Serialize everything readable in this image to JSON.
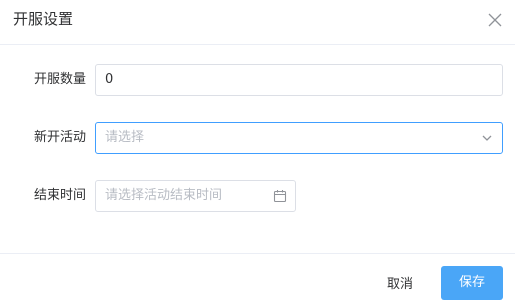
{
  "dialog": {
    "title": "开服设置"
  },
  "form": {
    "server_count": {
      "label": "开服数量",
      "value": "0"
    },
    "new_activity": {
      "label": "新开活动",
      "placeholder": "请选择"
    },
    "end_time": {
      "label": "结束时间",
      "placeholder": "请选择活动结束时间"
    }
  },
  "footer": {
    "cancel_label": "取消",
    "save_label": "保存"
  },
  "colors": {
    "primary": "#4aa6f7",
    "focus_border": "#409eff",
    "border": "#dcdfe6",
    "placeholder": "#b8bcc4"
  },
  "icons": {
    "close": "close-icon",
    "dropdown": "chevron-down-icon",
    "date": "calendar-icon"
  }
}
